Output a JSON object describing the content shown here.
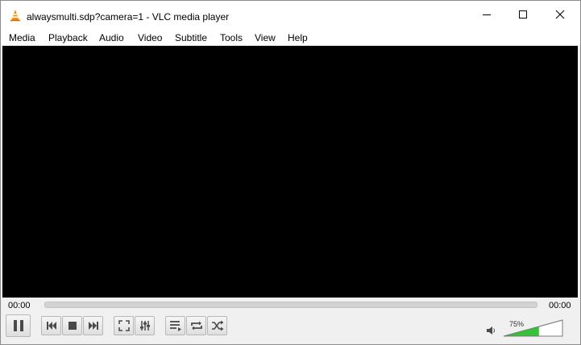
{
  "window": {
    "title": "alwaysmulti.sdp?camera=1 - VLC media player",
    "icons": {
      "app": "vlc-cone-icon",
      "minimize": "minimize-icon",
      "maximize": "maximize-icon",
      "close": "close-icon"
    }
  },
  "menubar": {
    "items": [
      "Media",
      "Playback",
      "Audio",
      "Video",
      "Subtitle",
      "Tools",
      "View",
      "Help"
    ]
  },
  "player": {
    "elapsed": "00:00",
    "total": "00:00",
    "progress": 0.0
  },
  "controls": {
    "buttons": [
      "pause-icon",
      "previous-icon",
      "stop-icon",
      "next-icon",
      "fullscreen-icon",
      "extended-settings-icon",
      "playlist-icon",
      "loop-icon",
      "shuffle-icon"
    ]
  },
  "volume": {
    "percent_label": "75%",
    "level": 0.75,
    "icon": "speaker-icon",
    "fill_color": "#36c236"
  }
}
